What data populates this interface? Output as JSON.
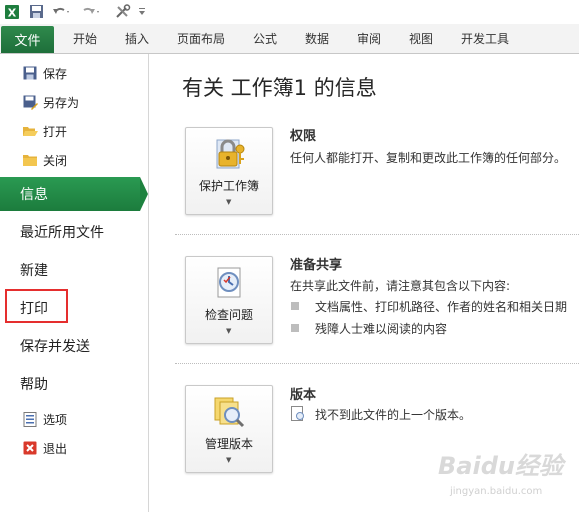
{
  "quick_access": {
    "icons": [
      "excel-app-icon",
      "save-icon",
      "undo-icon",
      "redo-icon",
      "customize-tools-icon",
      "qat-dropdown-icon"
    ]
  },
  "ribbon": {
    "file_tab": "文件",
    "tabs": [
      "开始",
      "插入",
      "页面布局",
      "公式",
      "数据",
      "审阅",
      "视图",
      "开发工具"
    ]
  },
  "nav": {
    "small_top": [
      {
        "label": "保存",
        "icon": "save-icon"
      },
      {
        "label": "另存为",
        "icon": "save-as-icon"
      },
      {
        "label": "打开",
        "icon": "open-folder-icon"
      },
      {
        "label": "关闭",
        "icon": "close-folder-icon"
      }
    ],
    "big": [
      {
        "label": "信息",
        "active": true
      },
      {
        "label": "最近所用文件"
      },
      {
        "label": "新建"
      },
      {
        "label": "打印",
        "highlighted": true
      },
      {
        "label": "保存并发送"
      },
      {
        "label": "帮助"
      }
    ],
    "small_bottom": [
      {
        "label": "选项",
        "icon": "options-icon"
      },
      {
        "label": "退出",
        "icon": "exit-icon"
      }
    ]
  },
  "main": {
    "title": "有关 工作簿1 的信息",
    "sections": [
      {
        "button_label": "保护工作簿",
        "heading": "权限",
        "text": "任何人都能打开、复制和更改此工作簿的任何部分。"
      },
      {
        "button_label": "检查问题",
        "heading": "准备共享",
        "text": "在共享此文件前，请注意其包含以下内容:",
        "bullets": [
          "文档属性、打印机路径、作者的姓名和相关日期",
          "残障人士难以阅读的内容"
        ]
      },
      {
        "button_label": "管理版本",
        "heading": "版本",
        "text": "找不到此文件的上一个版本。"
      }
    ]
  },
  "colors": {
    "accent_green": "#1f8a45",
    "highlight_red": "#e52e2e"
  },
  "watermark": {
    "brand": "Baidu经验",
    "url": "jingyan.baidu.com"
  }
}
